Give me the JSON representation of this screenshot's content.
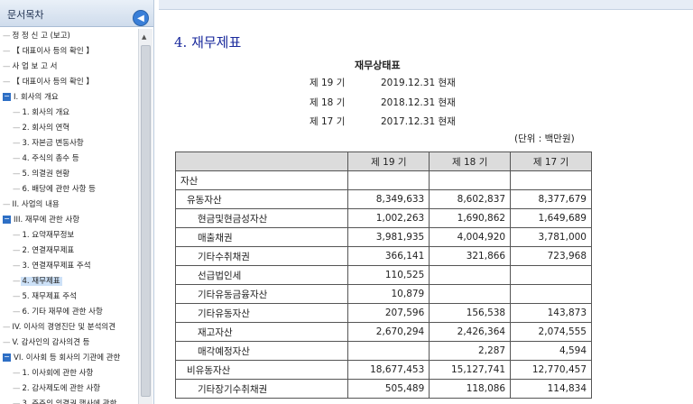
{
  "sidebar": {
    "title": "문서목차",
    "collapse_icon": "◀",
    "items": [
      {
        "label": "정 정 신 고 (보고)",
        "prefix": "—"
      },
      {
        "label": "【 대표이사 등의 확인 】",
        "prefix": "—"
      },
      {
        "label": "사 업 보 고 서",
        "prefix": "—"
      },
      {
        "label": "【 대표이사 등의 확인 】",
        "prefix": "—"
      },
      {
        "label": "I. 회사의 개요",
        "prefix": "",
        "expanded": true
      },
      {
        "label": "1. 회사의 개요",
        "prefix": "—"
      },
      {
        "label": "2. 회사의 연혁",
        "prefix": "—"
      },
      {
        "label": "3. 자본금 변동사항",
        "prefix": "—"
      },
      {
        "label": "4. 주식의 총수 등",
        "prefix": "—"
      },
      {
        "label": "5. 의결권 현황",
        "prefix": "—"
      },
      {
        "label": "6. 배당에 관한 사항 등",
        "prefix": "—"
      },
      {
        "label": "II. 사업의 내용",
        "prefix": "—"
      },
      {
        "label": "III. 재무에 관한 사항",
        "prefix": "",
        "expanded": true
      },
      {
        "label": "1. 요약재무정보",
        "prefix": "—"
      },
      {
        "label": "2. 연결재무제표",
        "prefix": "—"
      },
      {
        "label": "3. 연결재무제표 주석",
        "prefix": "—"
      },
      {
        "label": "4. 재무제표",
        "prefix": "—",
        "selected": true
      },
      {
        "label": "5. 재무제표 주석",
        "prefix": "—"
      },
      {
        "label": "6. 기타 재무에 관한 사항",
        "prefix": "—"
      },
      {
        "label": "IV. 이사의 경영진단 및 분석의견",
        "prefix": "—"
      },
      {
        "label": "V. 감사인의 감사의견 등",
        "prefix": "—"
      },
      {
        "label": "VI. 이사회 등 회사의 기관에 관한",
        "prefix": "",
        "expanded": true
      },
      {
        "label": "1. 이사회에 관한 사항",
        "prefix": "—"
      },
      {
        "label": "2. 감사제도에 관한 사항",
        "prefix": "—"
      },
      {
        "label": "3. 주주의 의결권 행사에 관한",
        "prefix": "—"
      }
    ]
  },
  "main": {
    "page_title": "4. 재무제표",
    "doc_title": "재무상태표",
    "periods": [
      {
        "term": "제 19 기",
        "date": "2019.12.31 현재"
      },
      {
        "term": "제 18 기",
        "date": "2018.12.31 현재"
      },
      {
        "term": "제 17 기",
        "date": "2017.12.31 현재"
      }
    ],
    "unit": "(단위 : 백만원)",
    "table": {
      "headers": [
        "",
        "제 19 기",
        "제 18 기",
        "제 17 기"
      ],
      "rows": [
        {
          "label": "자산",
          "level": 0,
          "values": [
            "",
            "",
            ""
          ]
        },
        {
          "label": "유동자산",
          "level": 1,
          "values": [
            "8,349,633",
            "8,602,837",
            "8,377,679"
          ]
        },
        {
          "label": "현금및현금성자산",
          "level": 2,
          "values": [
            "1,002,263",
            "1,690,862",
            "1,649,689"
          ]
        },
        {
          "label": "매출채권",
          "level": 2,
          "values": [
            "3,981,935",
            "4,004,920",
            "3,781,000"
          ]
        },
        {
          "label": "기타수취채권",
          "level": 2,
          "values": [
            "366,141",
            "321,866",
            "723,968"
          ]
        },
        {
          "label": "선급법인세",
          "level": 2,
          "values": [
            "110,525",
            "",
            ""
          ]
        },
        {
          "label": "기타유동금융자산",
          "level": 2,
          "values": [
            "10,879",
            "",
            ""
          ]
        },
        {
          "label": "기타유동자산",
          "level": 2,
          "values": [
            "207,596",
            "156,538",
            "143,873"
          ]
        },
        {
          "label": "재고자산",
          "level": 2,
          "values": [
            "2,670,294",
            "2,426,364",
            "2,074,555"
          ]
        },
        {
          "label": "매각예정자산",
          "level": 2,
          "values": [
            "",
            "2,287",
            "4,594"
          ]
        },
        {
          "label": "비유동자산",
          "level": 1,
          "values": [
            "18,677,453",
            "15,127,741",
            "12,770,457"
          ]
        },
        {
          "label": "기타장기수취채권",
          "level": 2,
          "values": [
            "505,489",
            "118,086",
            "114,834"
          ]
        }
      ]
    }
  }
}
